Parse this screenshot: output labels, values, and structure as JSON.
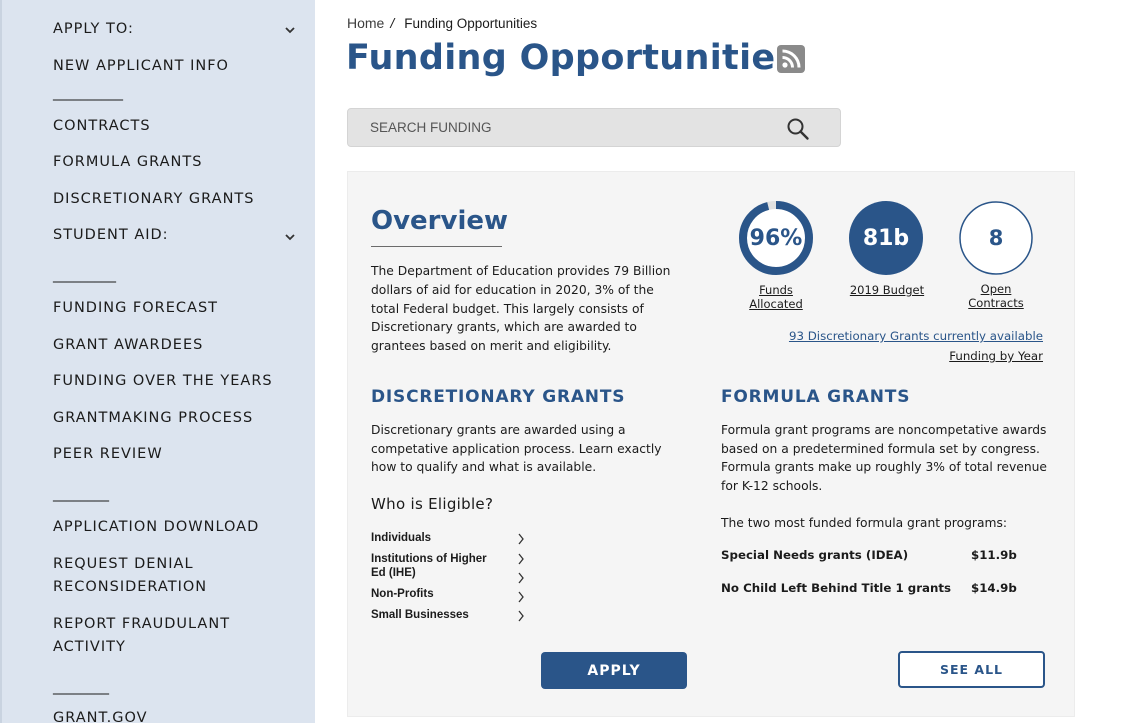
{
  "sidebar": {
    "apply_to": "APPLY TO:",
    "new_applicant": "NEW APPLICANT INFO",
    "contracts": "CONTRACTS",
    "formula_grants": "FORMULA GRANTS",
    "discretionary_grants": "DISCRETIONARY GRANTS",
    "student_aid": "STUDENT AID:",
    "funding_forecast": "FUNDING FORECAST",
    "grant_awardees": "GRANT AWARDEES",
    "funding_over_years": "FUNDING OVER THE YEARS",
    "grantmaking_process": "GRANTMAKING PROCESS",
    "peer_review": "PEER REVIEW",
    "application_download": "APPLICATION DOWNLOAD",
    "request_denial": "REQUEST DENIAL RECONSIDERATION",
    "report_fraudulent": "REPORT FRAUDULANT ACTIVITY",
    "grant_gov": "GRANT.GOV",
    "divider_1": "__________",
    "divider_2": "_________",
    "divider_3": "________",
    "divider_4": "________"
  },
  "breadcrumb": {
    "home": "Home",
    "separator": "/",
    "current": "Funding Opportunities"
  },
  "page": {
    "title": "Funding Opportunities"
  },
  "search": {
    "placeholder": "SEARCH FUNDING"
  },
  "overview": {
    "title": "Overview",
    "text": "The Department of Education provides 79 Billion dollars of aid for education in 2020, 3% of the total Federal budget. This largely consists of Discretionary grants, which are awarded to grantees based on merit and eligibility."
  },
  "stats": {
    "funds": {
      "value": "96%",
      "label": "Funds Allocated",
      "fraction": 0.96
    },
    "budget": {
      "value": "81b",
      "label": "2019 Budget"
    },
    "contracts": {
      "value": "8",
      "label": "Open Contracts"
    }
  },
  "links": {
    "discretionary_available": "93 Discretionary Grants currently available",
    "funding_by_year": "Funding by Year"
  },
  "discretionary": {
    "title": "DISCRETIONARY GRANTS",
    "text": "Discretionary grants are awarded using a competative application process. Learn exactly how to qualify and what is available.",
    "eligible_title": "Who is Eligible?",
    "eligible": [
      "Individuals",
      "Institutions of Higher Ed (IHE)",
      "Non-Profits",
      "Small Businesses"
    ]
  },
  "formula": {
    "title": "FORMULA GRANTS",
    "text": "Formula grant programs are noncompetative awards based on a predetermined formula set by congress. Formula grants make up roughly 3% of total revenue for K-12 schools.",
    "intro": "The two most funded formula grant programs:",
    "programs": [
      {
        "name": "Special Needs grants (IDEA)",
        "amount": "$11.9b"
      },
      {
        "name": "No Child Left Behind Title 1 grants",
        "amount": "$14.9b"
      }
    ]
  },
  "buttons": {
    "apply": "APPLY",
    "see_all": "SEE ALL"
  },
  "colors": {
    "brand_blue": "#2a5589",
    "sidebar_bg": "#dce4ef",
    "card_bg": "#f5f5f5"
  }
}
